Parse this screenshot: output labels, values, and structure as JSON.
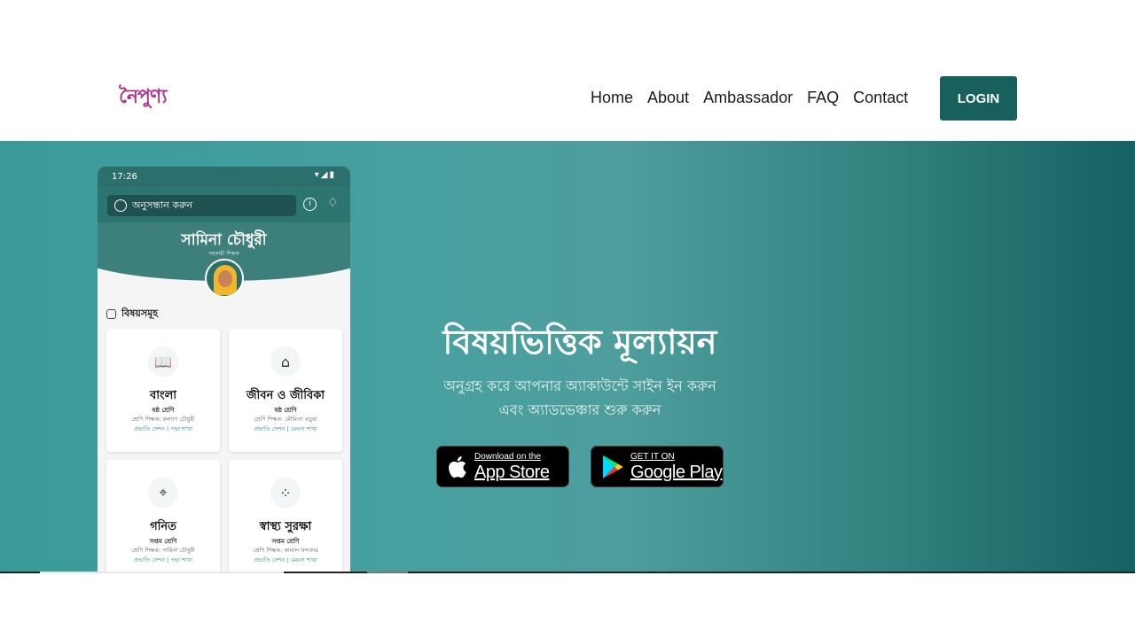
{
  "header": {
    "logo": "নৈপুণ্য",
    "nav": [
      "Home",
      "About",
      "Ambassador",
      "FAQ",
      "Contact"
    ],
    "login_label": "LOGIN"
  },
  "hero": {
    "title": "বিষয়ভিত্তিক মূল্যায়ন",
    "subtitle_line1": "অনুগ্রহ করে আপনার অ্যাকাউন্টে সাইন ইন করুন",
    "subtitle_line2": "এবং অ্যাডভেঞ্চার শুরু করুন",
    "app_store": {
      "small": "Download on the",
      "big": "App Store"
    },
    "google_play": {
      "small": "GET IT ON",
      "big": "Google Play"
    }
  },
  "phone": {
    "time": "17:26",
    "search_placeholder": "অনুসন্ধান করুন",
    "user_name": "সামিনা চৌধুরী",
    "user_role": "সহকারী শিক্ষক",
    "subjects_heading": "বিষয়সমূহ",
    "cards": [
      {
        "name": "বাংলা",
        "grade": "ষষ্ঠ শ্রেণি",
        "teacher": "শ্রেণি শিক্ষক: কল্যাণ চৌধুরী",
        "section": "প্রভাতি সেশন | পদ্মা শাখা"
      },
      {
        "name": "জীবন ও জীবিকা",
        "grade": "ষষ্ঠ শ্রেণি",
        "teacher": "শ্রেণি শিক্ষক: মৌমিতা বড়ুয়া",
        "section": "প্রভাতি সেশন | মেঘনা শাখা"
      },
      {
        "name": "গনিত",
        "grade": "সপ্তম শ্রেণি",
        "teacher": "শ্রেণি শিক্ষক: সামিনা চৌধুরী",
        "section": "প্রভাতি সেশন | পদ্মা শাখা"
      },
      {
        "name": "স্বাস্থ্য সুরক্ষা",
        "grade": "সপ্তম শ্রেণি",
        "teacher": "শ্রেণি শিক্ষক: কামাল খন্দকার",
        "section": "প্রভাতি সেশন | মেঘনা শাখা"
      }
    ]
  },
  "colors": {
    "brand": "#17605d",
    "logo": "#b0338f",
    "hero_start": "#3a9a9a",
    "hero_end": "#146261"
  }
}
